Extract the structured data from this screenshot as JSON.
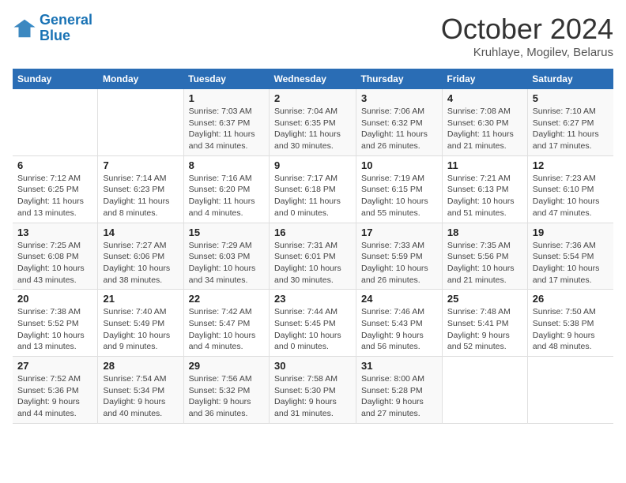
{
  "logo": {
    "line1": "General",
    "line2": "Blue"
  },
  "title": "October 2024",
  "subtitle": "Kruhlaye, Mogilev, Belarus",
  "days_header": [
    "Sunday",
    "Monday",
    "Tuesday",
    "Wednesday",
    "Thursday",
    "Friday",
    "Saturday"
  ],
  "weeks": [
    [
      {
        "day": "",
        "info": ""
      },
      {
        "day": "",
        "info": ""
      },
      {
        "day": "1",
        "info": "Sunrise: 7:03 AM\nSunset: 6:37 PM\nDaylight: 11 hours\nand 34 minutes."
      },
      {
        "day": "2",
        "info": "Sunrise: 7:04 AM\nSunset: 6:35 PM\nDaylight: 11 hours\nand 30 minutes."
      },
      {
        "day": "3",
        "info": "Sunrise: 7:06 AM\nSunset: 6:32 PM\nDaylight: 11 hours\nand 26 minutes."
      },
      {
        "day": "4",
        "info": "Sunrise: 7:08 AM\nSunset: 6:30 PM\nDaylight: 11 hours\nand 21 minutes."
      },
      {
        "day": "5",
        "info": "Sunrise: 7:10 AM\nSunset: 6:27 PM\nDaylight: 11 hours\nand 17 minutes."
      }
    ],
    [
      {
        "day": "6",
        "info": "Sunrise: 7:12 AM\nSunset: 6:25 PM\nDaylight: 11 hours\nand 13 minutes."
      },
      {
        "day": "7",
        "info": "Sunrise: 7:14 AM\nSunset: 6:23 PM\nDaylight: 11 hours\nand 8 minutes."
      },
      {
        "day": "8",
        "info": "Sunrise: 7:16 AM\nSunset: 6:20 PM\nDaylight: 11 hours\nand 4 minutes."
      },
      {
        "day": "9",
        "info": "Sunrise: 7:17 AM\nSunset: 6:18 PM\nDaylight: 11 hours\nand 0 minutes."
      },
      {
        "day": "10",
        "info": "Sunrise: 7:19 AM\nSunset: 6:15 PM\nDaylight: 10 hours\nand 55 minutes."
      },
      {
        "day": "11",
        "info": "Sunrise: 7:21 AM\nSunset: 6:13 PM\nDaylight: 10 hours\nand 51 minutes."
      },
      {
        "day": "12",
        "info": "Sunrise: 7:23 AM\nSunset: 6:10 PM\nDaylight: 10 hours\nand 47 minutes."
      }
    ],
    [
      {
        "day": "13",
        "info": "Sunrise: 7:25 AM\nSunset: 6:08 PM\nDaylight: 10 hours\nand 43 minutes."
      },
      {
        "day": "14",
        "info": "Sunrise: 7:27 AM\nSunset: 6:06 PM\nDaylight: 10 hours\nand 38 minutes."
      },
      {
        "day": "15",
        "info": "Sunrise: 7:29 AM\nSunset: 6:03 PM\nDaylight: 10 hours\nand 34 minutes."
      },
      {
        "day": "16",
        "info": "Sunrise: 7:31 AM\nSunset: 6:01 PM\nDaylight: 10 hours\nand 30 minutes."
      },
      {
        "day": "17",
        "info": "Sunrise: 7:33 AM\nSunset: 5:59 PM\nDaylight: 10 hours\nand 26 minutes."
      },
      {
        "day": "18",
        "info": "Sunrise: 7:35 AM\nSunset: 5:56 PM\nDaylight: 10 hours\nand 21 minutes."
      },
      {
        "day": "19",
        "info": "Sunrise: 7:36 AM\nSunset: 5:54 PM\nDaylight: 10 hours\nand 17 minutes."
      }
    ],
    [
      {
        "day": "20",
        "info": "Sunrise: 7:38 AM\nSunset: 5:52 PM\nDaylight: 10 hours\nand 13 minutes."
      },
      {
        "day": "21",
        "info": "Sunrise: 7:40 AM\nSunset: 5:49 PM\nDaylight: 10 hours\nand 9 minutes."
      },
      {
        "day": "22",
        "info": "Sunrise: 7:42 AM\nSunset: 5:47 PM\nDaylight: 10 hours\nand 4 minutes."
      },
      {
        "day": "23",
        "info": "Sunrise: 7:44 AM\nSunset: 5:45 PM\nDaylight: 10 hours\nand 0 minutes."
      },
      {
        "day": "24",
        "info": "Sunrise: 7:46 AM\nSunset: 5:43 PM\nDaylight: 9 hours\nand 56 minutes."
      },
      {
        "day": "25",
        "info": "Sunrise: 7:48 AM\nSunset: 5:41 PM\nDaylight: 9 hours\nand 52 minutes."
      },
      {
        "day": "26",
        "info": "Sunrise: 7:50 AM\nSunset: 5:38 PM\nDaylight: 9 hours\nand 48 minutes."
      }
    ],
    [
      {
        "day": "27",
        "info": "Sunrise: 7:52 AM\nSunset: 5:36 PM\nDaylight: 9 hours\nand 44 minutes."
      },
      {
        "day": "28",
        "info": "Sunrise: 7:54 AM\nSunset: 5:34 PM\nDaylight: 9 hours\nand 40 minutes."
      },
      {
        "day": "29",
        "info": "Sunrise: 7:56 AM\nSunset: 5:32 PM\nDaylight: 9 hours\nand 36 minutes."
      },
      {
        "day": "30",
        "info": "Sunrise: 7:58 AM\nSunset: 5:30 PM\nDaylight: 9 hours\nand 31 minutes."
      },
      {
        "day": "31",
        "info": "Sunrise: 8:00 AM\nSunset: 5:28 PM\nDaylight: 9 hours\nand 27 minutes."
      },
      {
        "day": "",
        "info": ""
      },
      {
        "day": "",
        "info": ""
      }
    ]
  ]
}
